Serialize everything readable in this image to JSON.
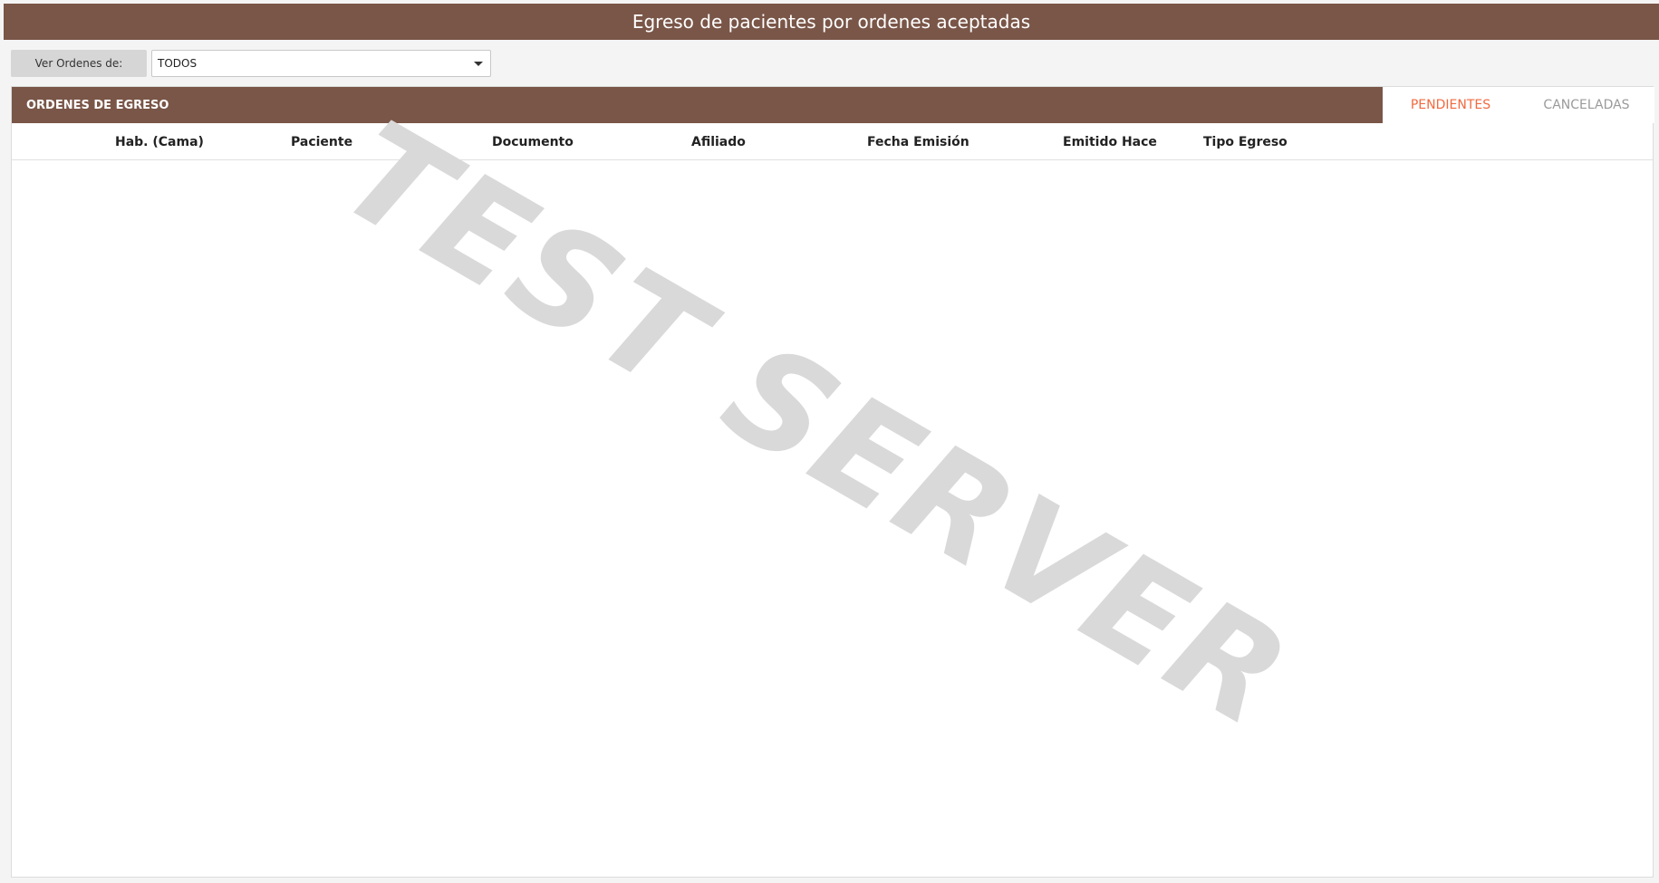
{
  "page": {
    "title": "Egreso de pacientes por ordenes aceptadas"
  },
  "filter": {
    "label": "Ver Ordenes de:",
    "selected": "TODOS"
  },
  "panel": {
    "title": "ORDENES DE EGRESO",
    "tabs": [
      {
        "label": "PENDIENTES",
        "active": true
      },
      {
        "label": "CANCELADAS",
        "active": false
      }
    ],
    "columns": [
      "Hab. (Cama)",
      "Paciente",
      "Documento",
      "Afiliado",
      "Fecha Emisión",
      "Emitido Hace",
      "Tipo Egreso"
    ],
    "rows": []
  },
  "watermark": "TEST SERVER",
  "colors": {
    "brand": "#7a5648",
    "active_tab": "#f2693f",
    "inactive_tab": "#9a9a9a"
  }
}
